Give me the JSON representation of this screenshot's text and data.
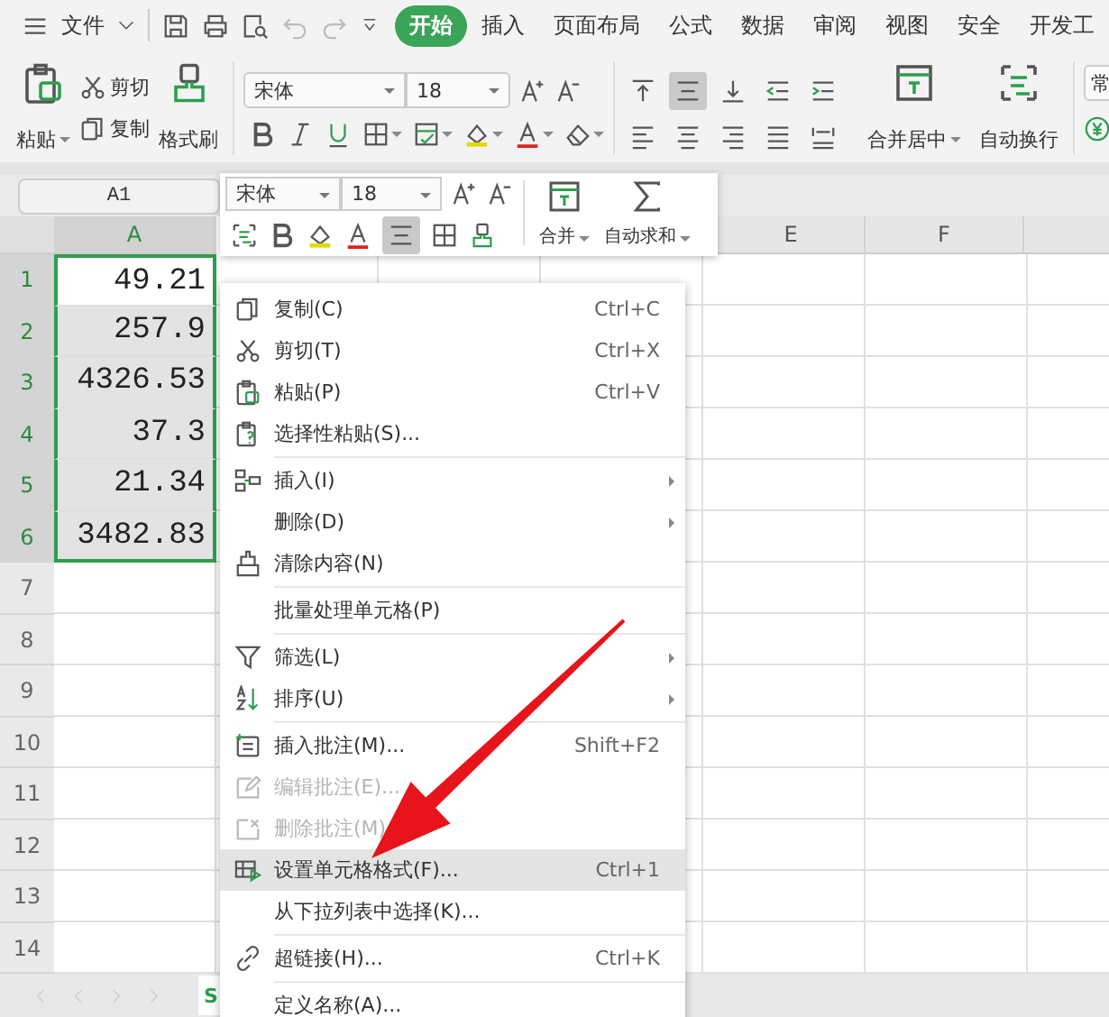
{
  "menu_bar": {
    "file_label": "文件",
    "tabs": [
      {
        "label": "开始",
        "selected": true
      },
      {
        "label": "插入",
        "selected": false
      },
      {
        "label": "页面布局",
        "selected": false
      },
      {
        "label": "公式",
        "selected": false
      },
      {
        "label": "数据",
        "selected": false
      },
      {
        "label": "审阅",
        "selected": false
      },
      {
        "label": "视图",
        "selected": false
      },
      {
        "label": "安全",
        "selected": false
      },
      {
        "label": "开发工",
        "selected": false
      }
    ]
  },
  "ribbon": {
    "paste_label": "粘贴",
    "cut_label": "剪切",
    "copy_label": "复制",
    "format_painter_label": "格式刷",
    "font": "宋体",
    "font_size": "18",
    "merge_label": "合并居中",
    "wrap_label": "自动换行",
    "number_format": "常",
    "alignment": [
      {
        "selected": false
      },
      {
        "selected": true
      },
      {
        "selected": false
      },
      {
        "selected": false
      },
      {
        "selected": false
      }
    ]
  },
  "formula_bar": {
    "name_box": "A1"
  },
  "mini_toolbar": {
    "font": "宋体",
    "font_size": "18",
    "merge_label": "合并",
    "autosum_label": "自动求和",
    "align_selected": true
  },
  "sheet": {
    "columns": [
      {
        "label": "A",
        "selected": true
      },
      {
        "label": "E",
        "selected": false
      },
      {
        "label": "F",
        "selected": false
      }
    ],
    "rows": [
      {
        "label": "1",
        "selected": true,
        "cells": [
          {
            "text": "49.21",
            "active": true
          }
        ]
      },
      {
        "label": "2",
        "selected": true,
        "cells": [
          {
            "text": "257.9",
            "active": false
          }
        ]
      },
      {
        "label": "3",
        "selected": true,
        "cells": [
          {
            "text": "4326.53",
            "active": false
          }
        ]
      },
      {
        "label": "4",
        "selected": true,
        "cells": [
          {
            "text": "37.3",
            "active": false
          }
        ]
      },
      {
        "label": "5",
        "selected": true,
        "cells": [
          {
            "text": "21.34",
            "active": false
          }
        ]
      },
      {
        "label": "6",
        "selected": true,
        "cells": [
          {
            "text": "3482.83",
            "active": false
          }
        ]
      },
      {
        "label": "7",
        "selected": false
      },
      {
        "label": "8",
        "selected": false
      },
      {
        "label": "9",
        "selected": false
      },
      {
        "label": "10",
        "selected": false
      },
      {
        "label": "11",
        "selected": false
      },
      {
        "label": "12",
        "selected": false
      },
      {
        "label": "13",
        "selected": false
      },
      {
        "label": "14",
        "selected": false
      }
    ]
  },
  "sheet_tabs": [
    {
      "label": "S",
      "selected": true
    }
  ],
  "context_menu": {
    "items": [
      {
        "kind": "item",
        "label": "复制(C)",
        "shortcut": "Ctrl+C",
        "disabled": false,
        "highlighted": false,
        "submenu": false
      },
      {
        "kind": "item",
        "label": "剪切(T)",
        "shortcut": "Ctrl+X",
        "disabled": false,
        "highlighted": false,
        "submenu": false
      },
      {
        "kind": "item",
        "label": "粘贴(P)",
        "shortcut": "Ctrl+V",
        "disabled": false,
        "highlighted": false,
        "submenu": false
      },
      {
        "kind": "item",
        "label": "选择性粘贴(S)...",
        "disabled": false,
        "highlighted": false,
        "submenu": false
      },
      {
        "kind": "separator"
      },
      {
        "kind": "item",
        "label": "插入(I)",
        "disabled": false,
        "highlighted": false,
        "submenu": true
      },
      {
        "kind": "item",
        "label": "删除(D)",
        "disabled": false,
        "highlighted": false,
        "submenu": true
      },
      {
        "kind": "item",
        "label": "清除内容(N)",
        "disabled": false,
        "highlighted": false,
        "submenu": false
      },
      {
        "kind": "separator"
      },
      {
        "kind": "item",
        "label": "批量处理单元格(P)",
        "disabled": false,
        "highlighted": false,
        "submenu": false
      },
      {
        "kind": "separator"
      },
      {
        "kind": "item",
        "label": "筛选(L)",
        "disabled": false,
        "highlighted": false,
        "submenu": true
      },
      {
        "kind": "item",
        "label": "排序(U)",
        "disabled": false,
        "highlighted": false,
        "submenu": true
      },
      {
        "kind": "separator"
      },
      {
        "kind": "item",
        "label": "插入批注(M)...",
        "shortcut": "Shift+F2",
        "disabled": false,
        "highlighted": false,
        "submenu": false
      },
      {
        "kind": "item",
        "label": "编辑批注(E)...",
        "disabled": true,
        "highlighted": false,
        "submenu": false
      },
      {
        "kind": "item",
        "label": "删除批注(M)",
        "disabled": true,
        "highlighted": false,
        "submenu": false
      },
      {
        "kind": "item",
        "label": "设置单元格格式(F)...",
        "shortcut": "Ctrl+1",
        "disabled": false,
        "highlighted": true,
        "submenu": false
      },
      {
        "kind": "item",
        "label": "从下拉列表中选择(K)...",
        "disabled": false,
        "highlighted": false,
        "submenu": false
      },
      {
        "kind": "separator"
      },
      {
        "kind": "item",
        "label": "超链接(H)...",
        "shortcut": "Ctrl+K",
        "disabled": false,
        "highlighted": false,
        "submenu": false
      },
      {
        "kind": "separator"
      },
      {
        "kind": "item",
        "label": "定义名称(A)...",
        "disabled": false,
        "highlighted": false,
        "submenu": false
      }
    ]
  }
}
